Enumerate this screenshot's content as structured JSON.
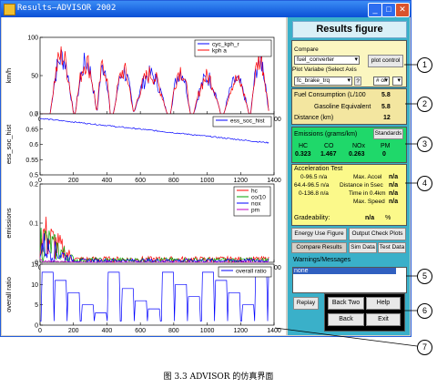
{
  "window": {
    "title": "Results—ADVISOR 2002"
  },
  "panel": {
    "title": "Results figure",
    "compare_label": "Compare",
    "compare_value": "fuel_converter",
    "plot_control": "plot control",
    "plot_var_label": "Plot Variabe (Select Axis",
    "plot_var_value": "fc_brake_trq",
    "help_q": "?",
    "axis_value": "# of",
    "fuel_label": "Fuel Consumption (L/100",
    "fuel_value": "5.8",
    "gas_eq_label": "Gasoline Equivalent",
    "gas_eq_value": "5.8",
    "distance_label": "Distance (km)",
    "distance_value": "12",
    "emissions_label": "Emissions (grams/km)",
    "standards_btn": "Standards",
    "em_headers": [
      "HC",
      "CO",
      "NOx",
      "PM"
    ],
    "em_values": [
      "0.323",
      "1.467",
      "0.263",
      "0"
    ],
    "accel_title": "Acceleration Test",
    "accel_rows": [
      {
        "l": "0-96.5 n/a",
        "r": "Max. Accel",
        "rv": "n/a"
      },
      {
        "l": "64.4-96.5 n/a",
        "r": "Distance in 5sec",
        "rv": "n/a"
      },
      {
        "l": "0-136.8 n/a",
        "r": "Time in 0.4km",
        "rv": "n/a"
      },
      {
        "l": "",
        "r": "Max. Speed",
        "rv": "n/a"
      }
    ],
    "gradeability_label": "Gradeability:",
    "gradeability_value": "n/a",
    "gradeability_unit": "%",
    "energy_btn": "Energy Use Figure",
    "output_btn": "Output Check Plots",
    "compare_results": "Compare Results",
    "sim_data": "Sim Data",
    "test_data": "Test Data",
    "warnings_label": "Warnings/Messages",
    "warnings_value": "none",
    "replay": "Replay",
    "back_two": "Back Two",
    "help": "Help",
    "back": "Back",
    "exit": "Exit"
  },
  "callouts": [
    "1",
    "2",
    "3",
    "4",
    "5",
    "6",
    "7"
  ],
  "caption": "图 3.3   ADVISOR 的仿真界面",
  "chart_data": [
    {
      "type": "line",
      "ylabel": "km/h",
      "xlim": [
        0,
        1400
      ],
      "ylim": [
        0,
        100
      ],
      "yticks": [
        "0",
        "50",
        "100"
      ],
      "xticks": [
        "0",
        "200",
        "400",
        "600",
        "800",
        "1000",
        "1200",
        "1400"
      ],
      "series": [
        {
          "name": "cyc_kph_r",
          "color": "#0000ff"
        },
        {
          "name": "kph a",
          "color": "#ff0000"
        }
      ]
    },
    {
      "type": "line",
      "ylabel": "ess_soc_hist",
      "xlim": [
        0,
        1400
      ],
      "ylim": [
        0.5,
        0.7
      ],
      "yticks": [
        "0.5",
        "0.55",
        "0.6",
        "0.65",
        "0.7"
      ],
      "xticks": [
        "0",
        "200",
        "400",
        "600",
        "800",
        "1000",
        "1200",
        "1400"
      ],
      "series": [
        {
          "name": "ess_soc_hist",
          "color": "#0000ff"
        }
      ]
    },
    {
      "type": "line",
      "ylabel": "emissions",
      "xlim": [
        0,
        1400
      ],
      "ylim": [
        0,
        0.2
      ],
      "yticks": [
        "0",
        "0.1",
        "0.2"
      ],
      "xticks": [
        "0",
        "200",
        "400",
        "600",
        "800",
        "1000",
        "1200",
        "1400"
      ],
      "series": [
        {
          "name": "hc",
          "color": "#ff0000"
        },
        {
          "name": "co/10",
          "color": "#00a000"
        },
        {
          "name": "nox",
          "color": "#0000ff"
        },
        {
          "name": "pm",
          "color": "#c000c0"
        }
      ]
    },
    {
      "type": "line",
      "ylabel": "overall ratio",
      "xlim": [
        0,
        1400
      ],
      "ylim": [
        0,
        15
      ],
      "yticks": [
        "0",
        "5",
        "10",
        "15"
      ],
      "xticks": [
        "0",
        "200",
        "400",
        "600",
        "800",
        "1000",
        "1200",
        "1400"
      ],
      "series": [
        {
          "name": "overall ratio",
          "color": "#0000ff"
        }
      ]
    }
  ]
}
